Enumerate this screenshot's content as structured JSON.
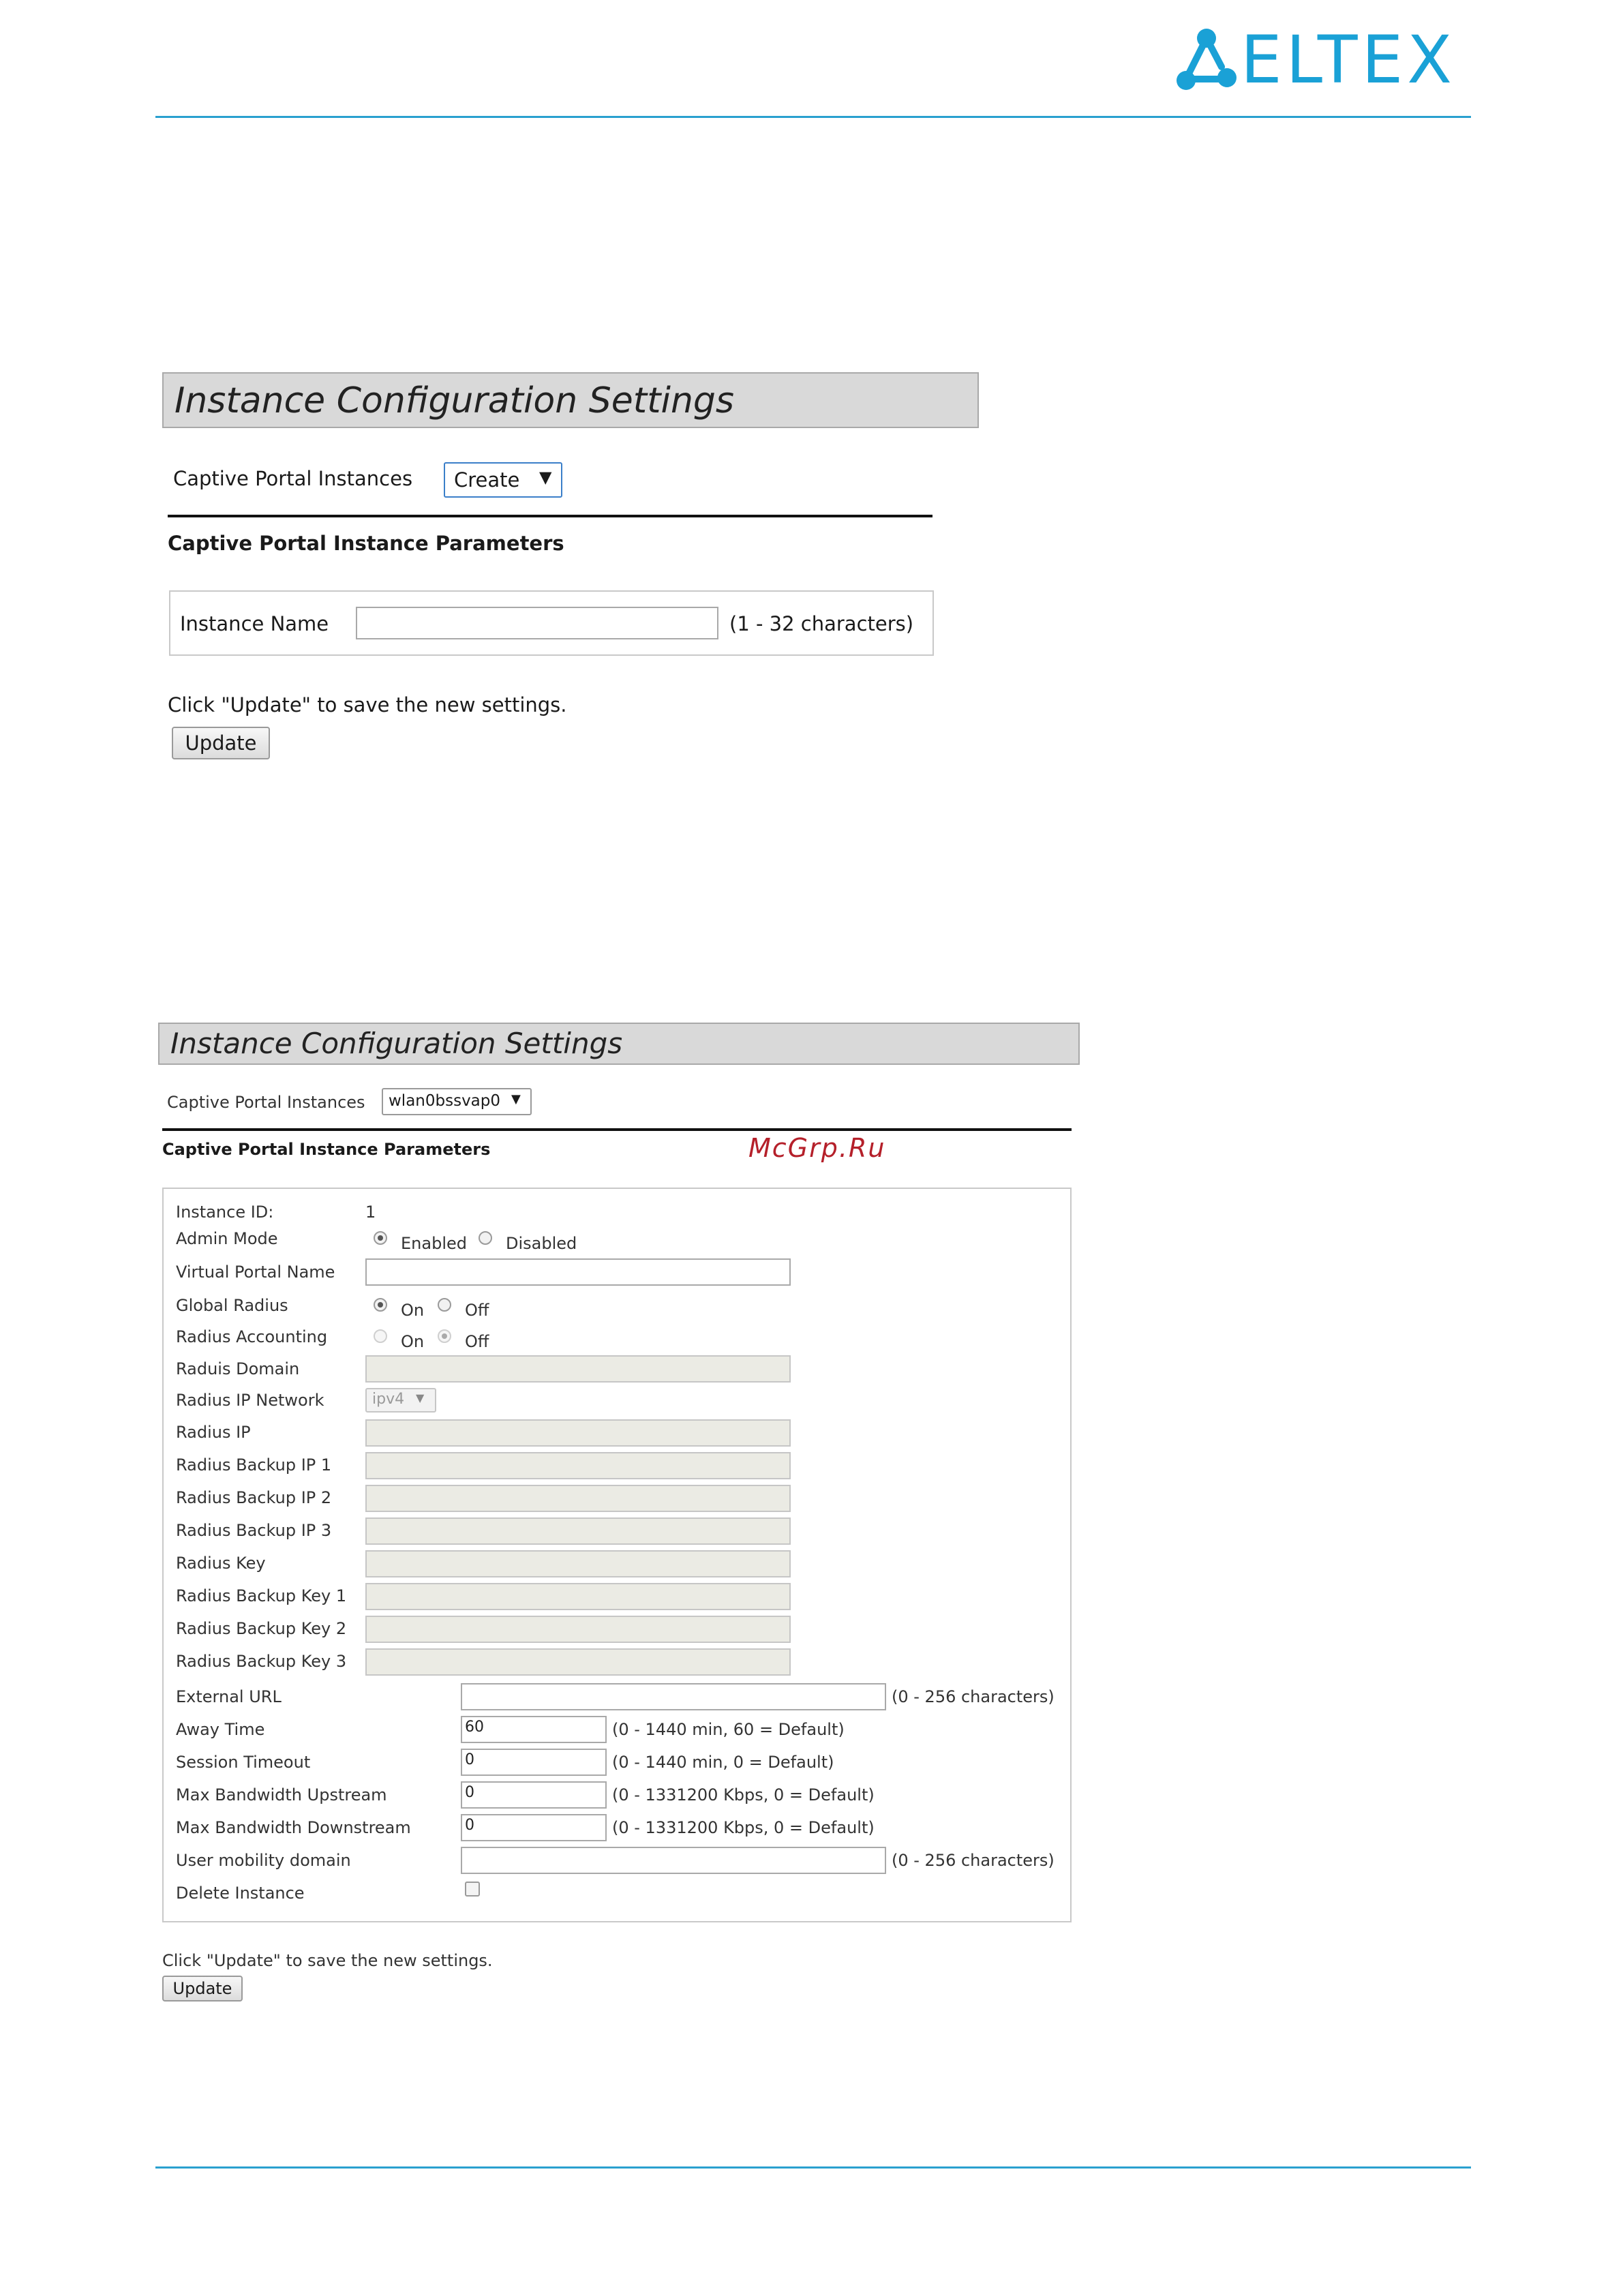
{
  "brand": {
    "logo_text": "ELTEX"
  },
  "watermark": "McGrp.Ru",
  "panel_a": {
    "title": "Instance Configuration Settings",
    "instances_label": "Captive Portal Instances",
    "instances_selected": "Create",
    "section_title": "Captive Portal Instance Parameters",
    "instance_name_label": "Instance Name",
    "instance_name_value": "",
    "instance_name_hint": "(1 - 32 characters)",
    "update_note": "Click \"Update\" to save the new settings.",
    "update_button": "Update"
  },
  "panel_b": {
    "title": "Instance Configuration Settings",
    "instances_label": "Captive Portal Instances",
    "instances_selected": "wlan0bssvap0",
    "section_title": "Captive Portal Instance Parameters",
    "instance_id_label": "Instance ID:",
    "instance_id_value": "1",
    "admin_mode_label": "Admin Mode",
    "admin_mode_enabled": "Enabled",
    "admin_mode_disabled": "Disabled",
    "virtual_portal_name_label": "Virtual Portal Name",
    "global_radius_label": "Global Radius",
    "global_radius_on": "On",
    "global_radius_off": "Off",
    "radius_accounting_label": "Radius Accounting",
    "radius_accounting_on": "On",
    "radius_accounting_off": "Off",
    "radius_domain_label": "Raduis Domain",
    "radius_ip_network_label": "Radius IP Network",
    "radius_ip_network_value": "ipv4",
    "radius_ip_label": "Radius IP",
    "radius_backup_ip1_label": "Radius Backup IP 1",
    "radius_backup_ip2_label": "Radius Backup IP 2",
    "radius_backup_ip3_label": "Radius Backup IP 3",
    "radius_key_label": "Radius Key",
    "radius_backup_key1_label": "Radius Backup Key 1",
    "radius_backup_key2_label": "Radius Backup Key 2",
    "radius_backup_key3_label": "Radius Backup Key 3",
    "external_url_label": "External URL",
    "external_url_hint": "(0 - 256 characters)",
    "away_time_label": "Away Time",
    "away_time_value": "60",
    "away_time_hint": "(0 - 1440 min, 60 = Default)",
    "session_timeout_label": "Session Timeout",
    "session_timeout_value": "0",
    "session_timeout_hint": "(0 - 1440 min, 0 = Default)",
    "max_bw_up_label": "Max Bandwidth Upstream",
    "max_bw_up_value": "0",
    "max_bw_up_hint": "(0 - 1331200 Kbps, 0 = Default)",
    "max_bw_down_label": "Max Bandwidth Downstream",
    "max_bw_down_value": "0",
    "max_bw_down_hint": "(0 - 1331200 Kbps, 0 = Default)",
    "user_mobility_label": "User mobility domain",
    "user_mobility_hint": "(0 - 256 characters)",
    "delete_instance_label": "Delete Instance",
    "update_note": "Click \"Update\" to save the new settings.",
    "update_button": "Update"
  }
}
